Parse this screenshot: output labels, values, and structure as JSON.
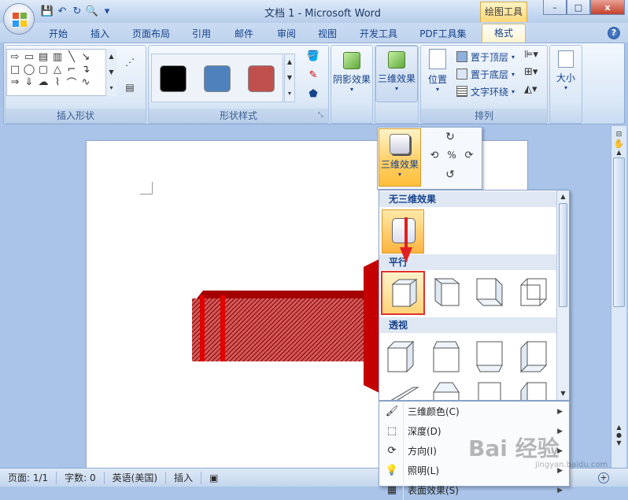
{
  "window": {
    "title": "文档 1 - Microsoft Word",
    "context_tab": "绘图工具",
    "minimize": "–",
    "maximize": "□",
    "close": "x"
  },
  "qat": {
    "save": "💾",
    "undo": "↶",
    "redo": "↻",
    "preview": "🔍",
    "more": "▾"
  },
  "tabs": [
    "开始",
    "插入",
    "页面布局",
    "引用",
    "邮件",
    "审阅",
    "视图",
    "开发工具",
    "PDF工具集",
    "格式"
  ],
  "help_icon": "?",
  "ribbon": {
    "insert_shapes": {
      "label": "插入形状"
    },
    "shape_styles": {
      "label": "形状样式",
      "swatches": [
        "#000000",
        "#4f81bd",
        "#c0504d"
      ]
    },
    "shadow": {
      "label": "阴影效果"
    },
    "effects3d": {
      "label": "三维效果"
    },
    "arrange": {
      "label": "排列",
      "position": "位置",
      "bring_front": "置于顶层",
      "send_back": "置于底层",
      "wrap": "文字环绕"
    },
    "size": {
      "label": "大小"
    }
  },
  "dropdown": {
    "btn_label": "三维效果",
    "none_header": "无三维效果",
    "parallel_header": "平行",
    "perspective_header": "透视",
    "menu": [
      {
        "label": "三维颜色(C)",
        "icon": "🖌"
      },
      {
        "label": "深度(D)",
        "icon": "⬚"
      },
      {
        "label": "方向(I)",
        "icon": "⟳"
      },
      {
        "label": "照明(L)",
        "icon": "💡"
      },
      {
        "label": "表面效果(S)",
        "icon": "▦"
      }
    ]
  },
  "status": {
    "page": "页面: 1/1",
    "words": "字数: 0",
    "lang": "英语(美国)",
    "mode": "插入"
  },
  "watermark": {
    "text": "Bai 经验",
    "url": "jingyan.baidu.com"
  }
}
